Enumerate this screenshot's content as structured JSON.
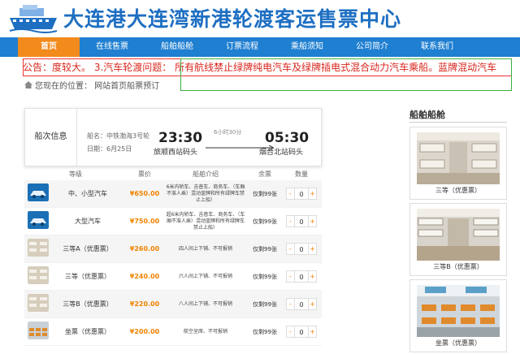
{
  "header": {
    "title": "大连港大连湾新港轮渡客运售票中心"
  },
  "nav": {
    "items": [
      "首页",
      "在线售票",
      "船舶船舱",
      "订票流程",
      "乘船须知",
      "公司简介",
      "联系我们"
    ]
  },
  "notice": {
    "label": "公告：",
    "text": "度较大。 3.汽车轮渡问题： 所有航线禁止绿牌纯电汽车及绿牌插电式混合动力汽车乘船。蓝牌混动汽车"
  },
  "breadcrumb": {
    "text": "您现在的位置： 网站首页船票预订"
  },
  "trip": {
    "label": "船次信息",
    "ship_label": "船名：中铁渤海3号轮",
    "date_label": "日期：6月25日",
    "dep_time": "23:30",
    "dep_port": "旅顺西站码头",
    "duration": "6小时30分",
    "arr_time": "05:30",
    "arr_port": "烟台北站码头"
  },
  "table": {
    "headers": [
      "等级",
      "票价",
      "船舶介绍",
      "余票",
      "数量"
    ],
    "rows": [
      {
        "grade": "中、小型汽车",
        "price": "¥650.00",
        "desc": "6米内轿车、吉普车、商务车、（车厢不准人乘）混动蓝牌和所有绿牌车禁止上船）",
        "stock": "仅剩99张",
        "qty": "0",
        "thumb": "car"
      },
      {
        "grade": "大型汽车",
        "price": "¥750.00",
        "desc": "超6米内轿车、吉普车、商务车、（车厢不准人乘）混动蓝牌和所有绿牌车禁止上船）",
        "stock": "仅剩99张",
        "qty": "0",
        "thumb": "car"
      },
      {
        "grade": "三等A（优惠票）",
        "price": "¥260.00",
        "desc": "四人间上下铺、不可报销",
        "stock": "仅剩99张",
        "qty": "0",
        "thumb": "cabin"
      },
      {
        "grade": "三等（优惠票）",
        "price": "¥240.00",
        "desc": "六人间上下铺、不可报销",
        "stock": "仅剩99张",
        "qty": "0",
        "thumb": "cabin"
      },
      {
        "grade": "三等B（优惠票）",
        "price": "¥220.00",
        "desc": "八人间上下铺、不可报销",
        "stock": "仅剩99张",
        "qty": "0",
        "thumb": "cabin"
      },
      {
        "grade": "坐票（优惠票）",
        "price": "¥200.00",
        "desc": "航空坐席、不可报销",
        "stock": "仅剩99张",
        "qty": "0",
        "thumb": "seat"
      }
    ],
    "minus": "-",
    "plus": "+"
  },
  "sidebar": {
    "title": "船舶船舱",
    "cabins": [
      {
        "label": "三等（优惠票）"
      },
      {
        "label": "三等B（优惠票）"
      },
      {
        "label": "坐票（优惠票）"
      }
    ]
  },
  "colors": {
    "brand": "#1e6fc2",
    "nav": "#1f7fd1",
    "active_nav": "#f28a1c",
    "price": "#f08300",
    "notice": "#d9261c",
    "highlight": "#3cb043"
  }
}
